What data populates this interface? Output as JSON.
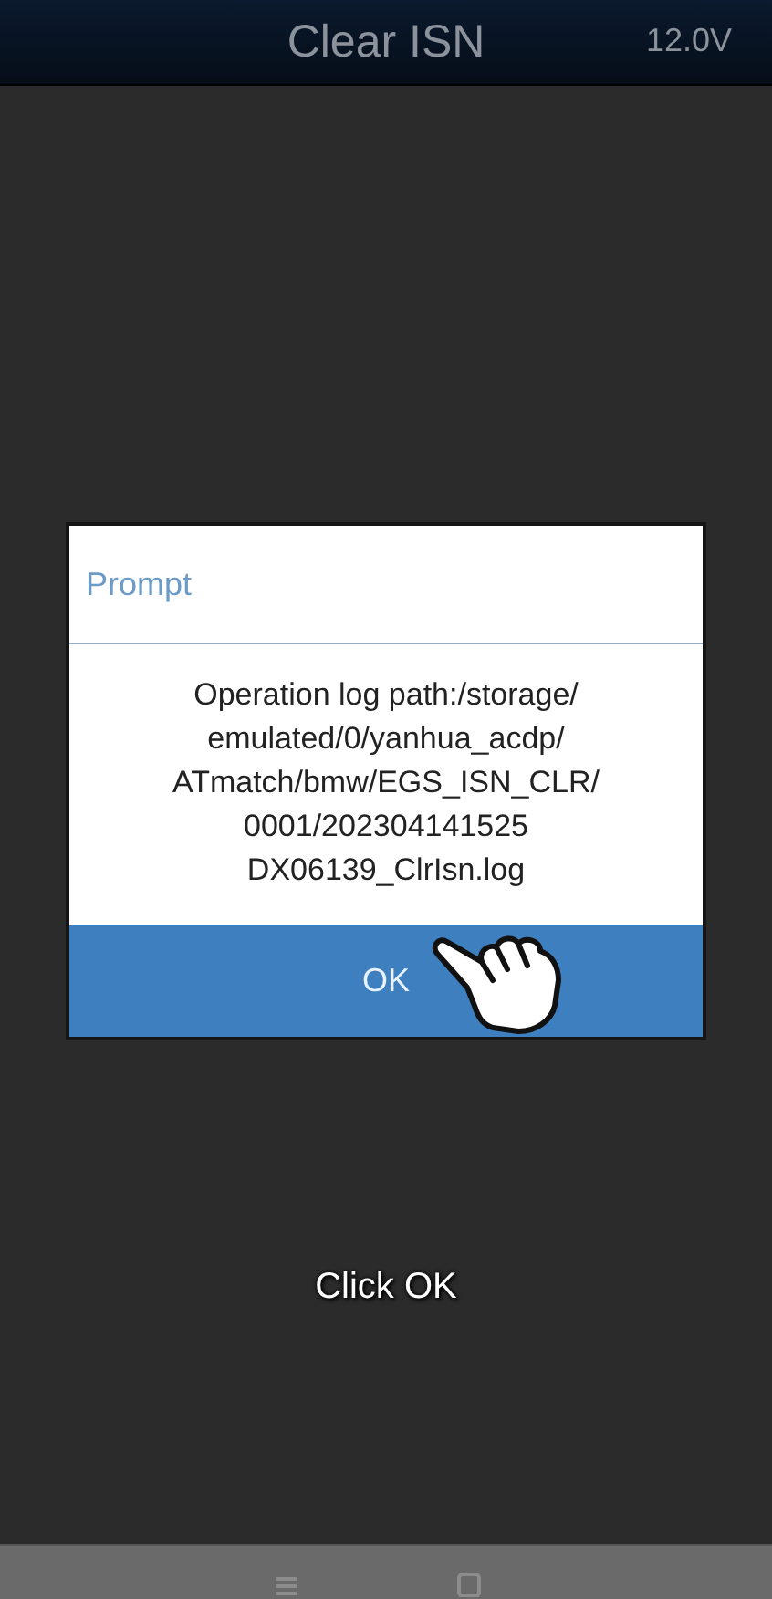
{
  "app_bar": {
    "title": "Clear ISN",
    "voltage": "12.0V"
  },
  "dialog": {
    "title": "Prompt",
    "message_lines": [
      "Operation log path:/storage/",
      "emulated/0/yanhua_acdp/",
      "ATmatch/bmw/EGS_ISN_CLR/",
      "0001/202304141525",
      "DX06139_ClrIsn.log"
    ],
    "button": "OK"
  },
  "caption": "Click OK"
}
